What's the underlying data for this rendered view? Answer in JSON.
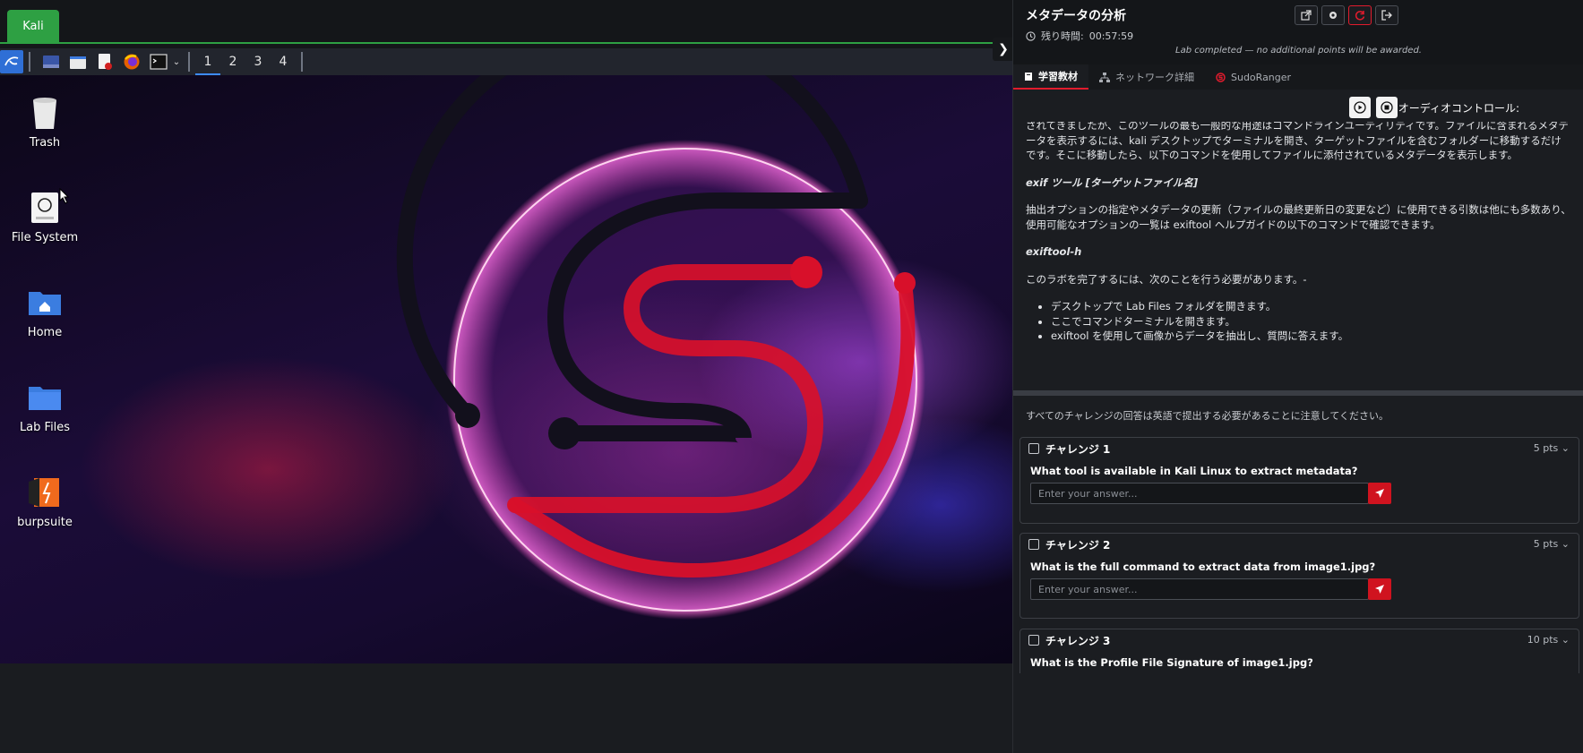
{
  "kali": {
    "tab_label": "Kali",
    "workspaces": [
      "1",
      "2",
      "3",
      "4"
    ],
    "desktop_icons": [
      {
        "label": "Trash"
      },
      {
        "label": "File System"
      },
      {
        "label": "Home"
      },
      {
        "label": "Lab Files"
      },
      {
        "label": "burpsuite"
      }
    ]
  },
  "lab": {
    "title": "メタデータの分析",
    "time_label": "残り時間:",
    "time_value": "00:57:59",
    "completed_msg": "Lab completed — no additional points will be awarded.",
    "tabs": [
      {
        "label": "学習教材"
      },
      {
        "label": "ネットワーク詳細"
      },
      {
        "label": "SudoRanger"
      }
    ],
    "audio_label": "オーディオコントロール:",
    "content": {
      "p1": "されてきましたが、このツールの最も一般的な用途はコマンドラインユーティリティです。ファイルに含まれるメタデータを表示するには、kali デスクトップでターミナルを開き、ターゲットファイルを含むフォルダーに移動するだけです。そこに移動したら、以下のコマンドを使用してファイルに添付されているメタデータを表示します。",
      "cmd1": "exif ツール [ターゲットファイル名]",
      "p2": "抽出オプションの指定やメタデータの更新（ファイルの最終更新日の変更など）に使用できる引数は他にも多数あり、使用可能なオプションの一覧は exiftool ヘルプガイドの以下のコマンドで確認できます。",
      "cmd2": "exiftool-h",
      "p3": "このラボを完了するには、次のことを行う必要があります。-",
      "bullets": [
        "デスクトップで Lab Files フォルダを開きます。",
        "ここでコマンドターミナルを開きます。",
        "exiftool を使用して画像からデータを抽出し、質問に答えます。"
      ]
    },
    "note": "すべてのチャレンジの回答は英語で提出する必要があることに注意してください。",
    "challenges": [
      {
        "title": "チャレンジ 1",
        "points": "5 pts",
        "question": "What tool is available in Kali Linux to extract metadata?",
        "placeholder": "Enter your answer..."
      },
      {
        "title": "チャレンジ 2",
        "points": "5 pts",
        "question": "What is the full command to extract data from image1.jpg?",
        "placeholder": "Enter your answer..."
      },
      {
        "title": "チャレンジ 3",
        "points": "10 pts",
        "question": "What is the Profile File Signature of image1.jpg?",
        "placeholder": "Enter your answer..."
      }
    ]
  }
}
